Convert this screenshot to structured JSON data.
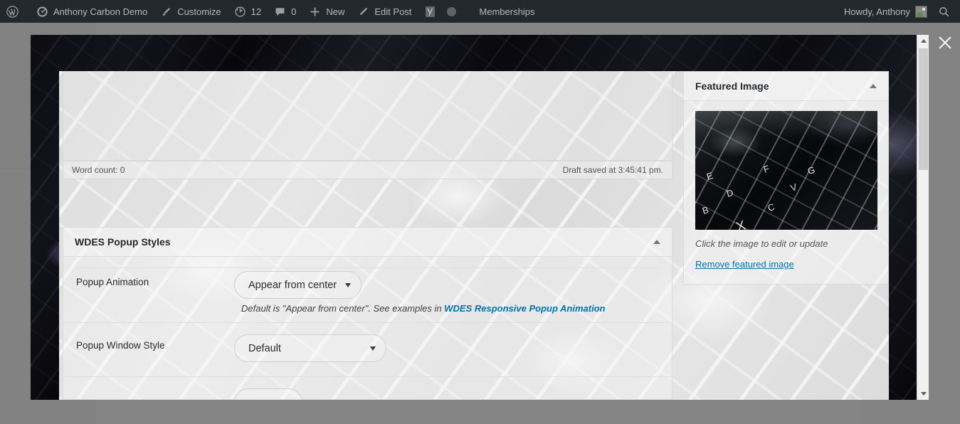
{
  "admin_bar": {
    "items": [
      {
        "id": "wp-logo",
        "icon": "wordpress-logo-icon",
        "label": ""
      },
      {
        "id": "site-name",
        "icon": "dashboard-icon",
        "label": "Anthony Carbon Demo"
      },
      {
        "id": "customize",
        "icon": "paintbrush-icon",
        "label": "Customize"
      },
      {
        "id": "updates",
        "icon": "updates-icon",
        "label": "12"
      },
      {
        "id": "comments",
        "icon": "comment-bubble-icon",
        "label": "0"
      },
      {
        "id": "new",
        "icon": "plus-icon",
        "label": "New"
      },
      {
        "id": "edit-post",
        "icon": "pencil-icon",
        "label": "Edit Post"
      },
      {
        "id": "yoast-seo",
        "icon": "yoast-seo-icon",
        "label": ""
      },
      {
        "id": "seo-status",
        "icon": "status-dot-icon",
        "label": ""
      },
      {
        "id": "memberships",
        "icon": "",
        "label": "Memberships"
      }
    ],
    "howdy": "Howdy, Anthony",
    "avatar_name": "avatar",
    "search_icon": "search-icon"
  },
  "modal": {
    "close_label": "Close",
    "close_icon": "close-icon",
    "scrollbar": {
      "up_icon": "scroll-up-arrow-icon",
      "down_icon": "scroll-down-arrow-icon"
    }
  },
  "editor": {
    "word_count": "Word count: 0",
    "draft_saved": "Draft saved at 3:45:41 pm."
  },
  "wdes_popup_styles": {
    "title": "WDES Popup Styles",
    "toggle_icon": "chevron-up-icon",
    "fields": [
      {
        "label": "Popup Animation",
        "value": "Appear from center",
        "hint_prefix": "Default is \"Appear from center\". See examples in ",
        "hint_link": "WDES Responsive Popup Animation"
      },
      {
        "label": "Popup Window Style",
        "value": "Default"
      }
    ]
  },
  "featured_image": {
    "title": "Featured Image",
    "toggle_icon": "chevron-up-icon",
    "thumbnail_name": "featured-image-thumbnail",
    "caption": "Click the image to edit or update",
    "remove_label": "Remove featured image"
  },
  "colors": {
    "admin_bar_bg": "#23282d",
    "admin_bar_text": "#b4b9be",
    "link_blue": "#0073aa",
    "overlay": "rgba(90,90,90,.72)",
    "panel_border": "#dcdcdc"
  }
}
